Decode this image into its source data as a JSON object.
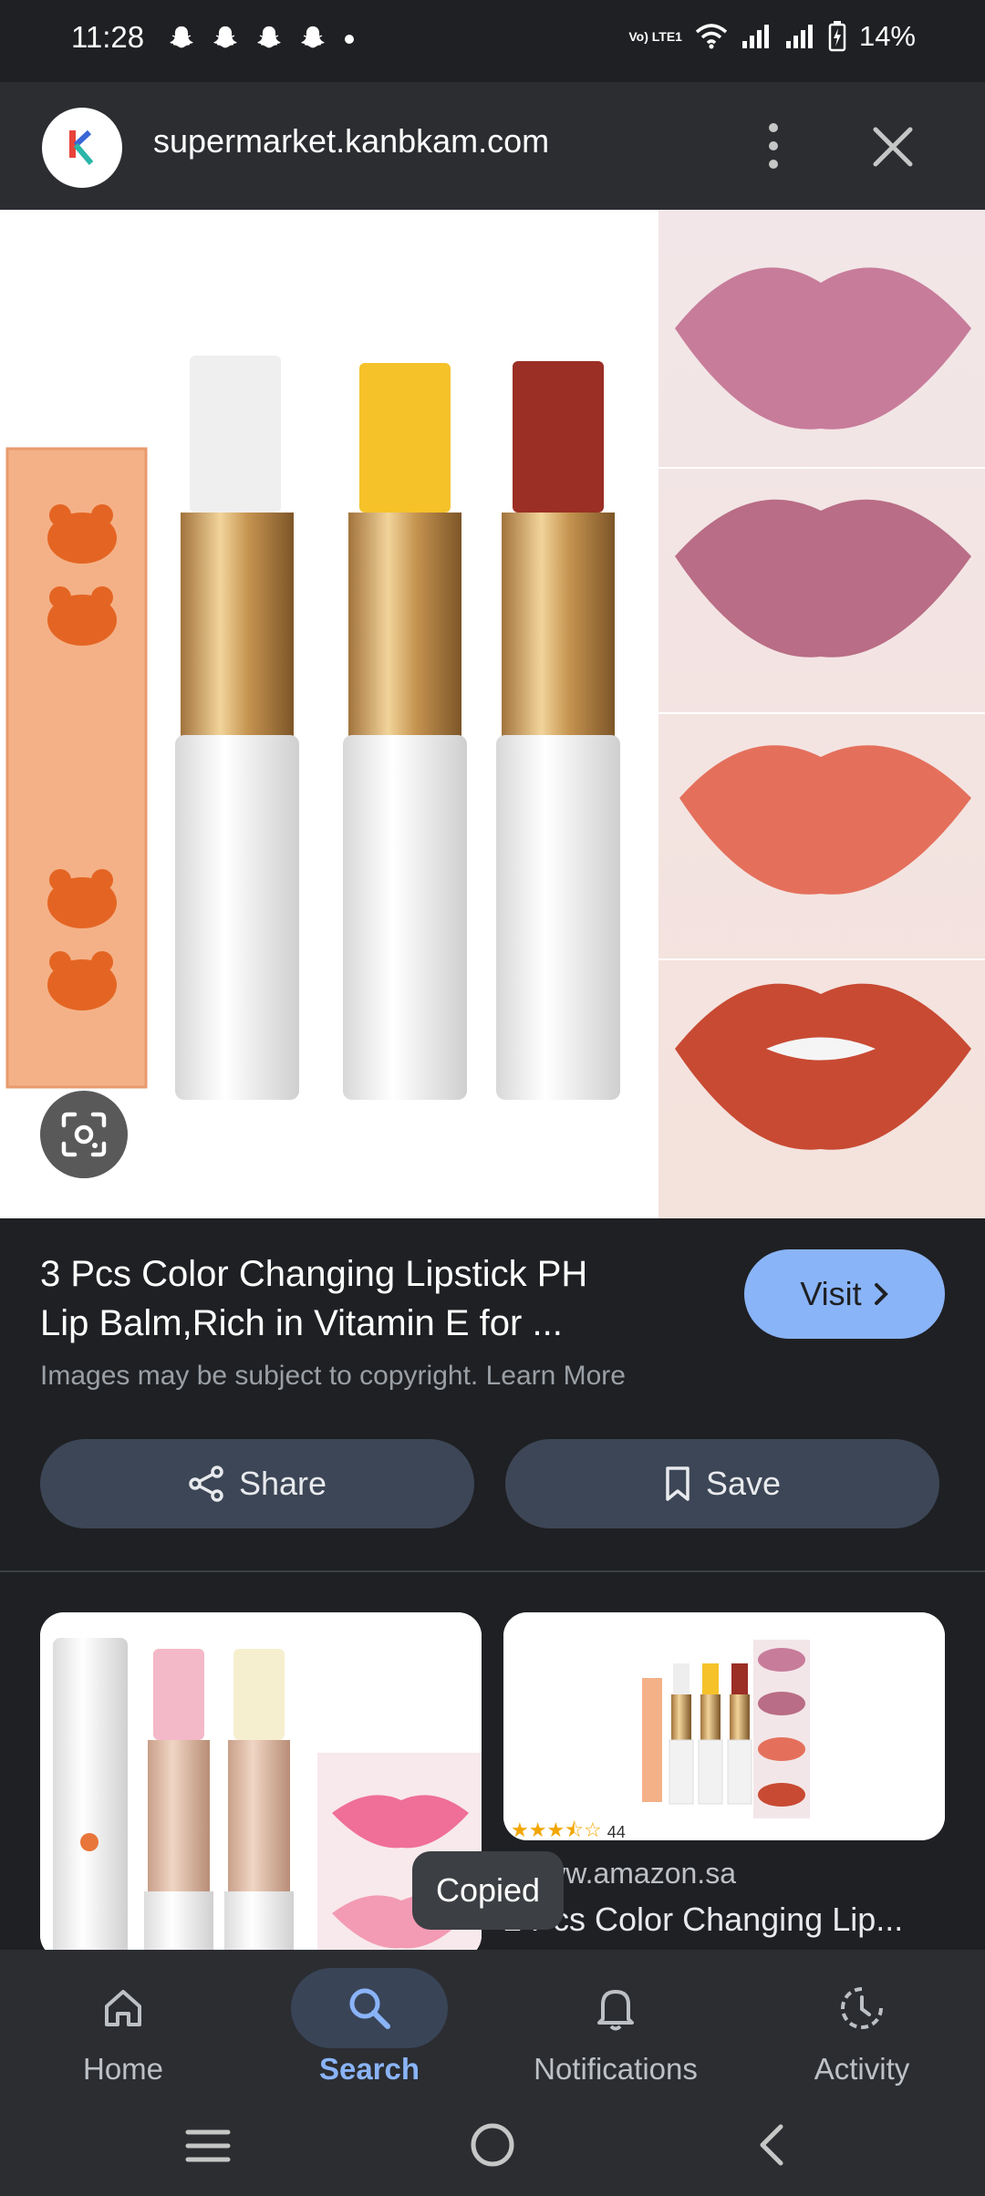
{
  "status_bar": {
    "time": "11:28",
    "network_badge": "Vo) LTE1",
    "battery_percent": "14%"
  },
  "browser": {
    "url": "supermarket.kanbkam.com"
  },
  "product": {
    "title_line1": "3 Pcs Color Changing Lipstick PH",
    "title_line2": "Lip Balm,Rich in Vitamin E for ...",
    "copyright_note": "Images may be subject to copyright. Learn More",
    "visit_label": "Visit",
    "share_label": "Share",
    "save_label": "Save"
  },
  "related": {
    "rating_count": "44",
    "source": "www.amazon.sa",
    "title": "2 Pcs Color Changing Lip..."
  },
  "toast": "Copied",
  "bottom_nav": {
    "items": [
      {
        "label": "Home",
        "icon": "home-icon"
      },
      {
        "label": "Search",
        "icon": "search-icon",
        "active": true
      },
      {
        "label": "Notifications",
        "icon": "bell-icon"
      },
      {
        "label": "Activity",
        "icon": "activity-icon"
      }
    ]
  },
  "colors": {
    "background": "#1f2023",
    "accent": "#8ab4f8",
    "chip": "#3c4656"
  }
}
